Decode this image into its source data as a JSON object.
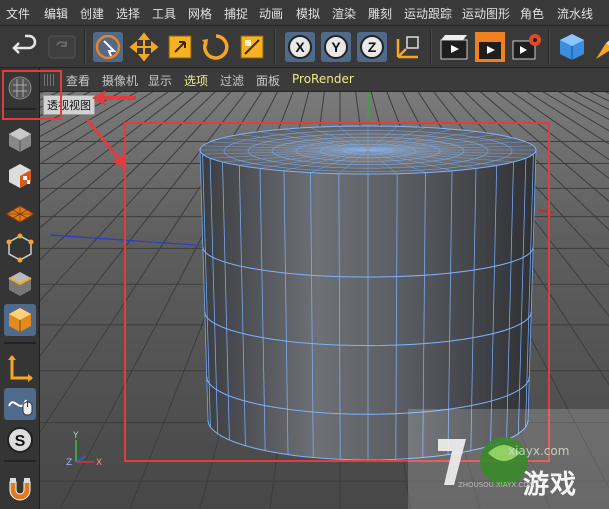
{
  "menu": {
    "items": [
      "文件",
      "编辑",
      "创建",
      "选择",
      "工具",
      "网格",
      "捕捉",
      "动画",
      "模拟",
      "渲染",
      "雕刻",
      "运动跟踪",
      "运动图形",
      "角色",
      "流水线"
    ]
  },
  "toolbar": {
    "undo_icon": "undo-icon",
    "redo_icon": "redo-icon",
    "tools": [
      "live-selection-icon",
      "move-icon",
      "scale-icon",
      "rotate-icon",
      "last-tool-icon"
    ],
    "axis_labels": [
      "X",
      "Y",
      "Z"
    ],
    "world_coords_icon": "coordinate-system-icon",
    "render_icons": [
      "render-view-icon",
      "render-to-picture-viewer-icon",
      "render-settings-icon"
    ],
    "object_icons": [
      "cube-icon",
      "pen-icon"
    ]
  },
  "left_palette": {
    "icons": [
      "make-editable-icon",
      "texture-mode-icon",
      "workplane-icon",
      "points-mode-icon",
      "edges-mode-icon",
      "polygons-mode-icon",
      "axis-mode-icon",
      "tweak-mode-icon",
      "snapping-icon",
      "magnet-icon"
    ],
    "selected_index": 5
  },
  "viewport_menu": {
    "items": [
      "查看",
      "摄像机",
      "显示",
      "选项",
      "过滤",
      "面板",
      "ProRender"
    ],
    "highlighted": [
      "选项",
      "ProRender"
    ]
  },
  "viewport": {
    "label": "透视视图",
    "axis_gizmo": {
      "x": "X",
      "y": "Y",
      "z": "Z"
    }
  },
  "watermark": {
    "url": "xiayx.com",
    "name": "游戏",
    "sub": "ZHOUSOU.XIAYX.COM"
  },
  "colors": {
    "menubar": "#3a3a3a",
    "viewport_bg": "#5a5a5a",
    "wire": "#7fb3ff",
    "annotation_red": "#e23c3c",
    "highlight_text": "#ecec8e"
  }
}
